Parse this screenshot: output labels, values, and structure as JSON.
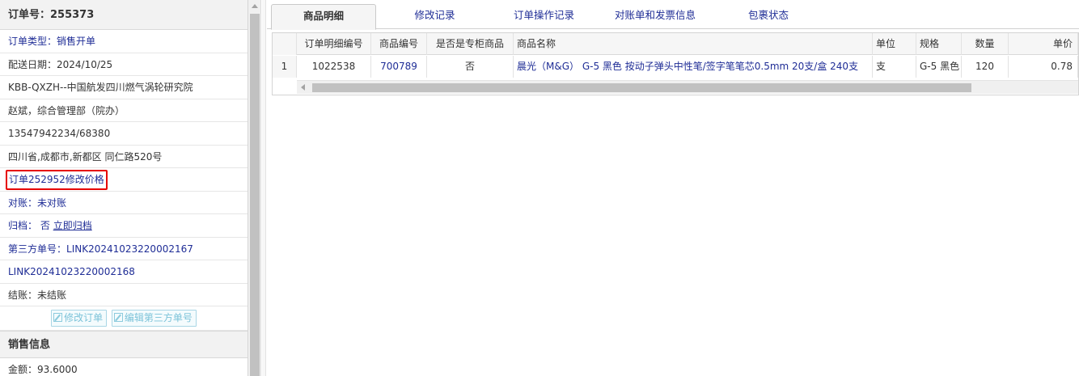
{
  "order": {
    "header": "订单号：255373",
    "type_label": "订单类型：",
    "type_value": "销售开单",
    "delivery_date": "配送日期：2024/10/25",
    "customer": "KBB-QXZH--中国航发四川燃气涡轮研究院",
    "contact": "赵斌，综合管理部（院办）",
    "phone": "13547942234/68380",
    "address": "四川省,成都市,新都区 同仁路520号",
    "price_change_note": "订单252952修改价格",
    "reconcile_label": "对账：",
    "reconcile_value": "未对账",
    "archive_label": "归档：",
    "archive_value": "否",
    "archive_action": "立即归档",
    "third_party_label": "第三方单号：",
    "third_party_no_1": "LINK20241023220002167",
    "third_party_no_2": "LINK20241023220002168",
    "settle": "结账：未结账",
    "btn_edit_order": "修改订单",
    "btn_edit_third": "编辑第三方单号"
  },
  "sales": {
    "section_title": "销售信息",
    "amount": "金额：93.6000"
  },
  "tabs": [
    {
      "label": "商品明细",
      "active": true
    },
    {
      "label": "修改记录"
    },
    {
      "label": "订单操作记录"
    },
    {
      "label": "对账单和发票信息"
    },
    {
      "label": "包裹状态"
    }
  ],
  "grid": {
    "headers": [
      "订单明细编号",
      "商品编号",
      "是否是专柜商品",
      "商品名称",
      "单位",
      "规格",
      "数量",
      "单价"
    ],
    "rows": [
      {
        "index": "1",
        "detail_id": "1022538",
        "product_id": "700789",
        "is_counter": "否",
        "name": "晨光（M&G） G-5 黑色 按动子弹头中性笔/签字笔笔芯0.5mm 20支/盒 240支",
        "unit": "支",
        "spec": "G-5 黑色",
        "qty": "120",
        "price": "0.78"
      }
    ]
  },
  "colors": {
    "link": "#1f2d96",
    "highlight": "#e60000",
    "ghost_button": "#7cc3d9"
  }
}
